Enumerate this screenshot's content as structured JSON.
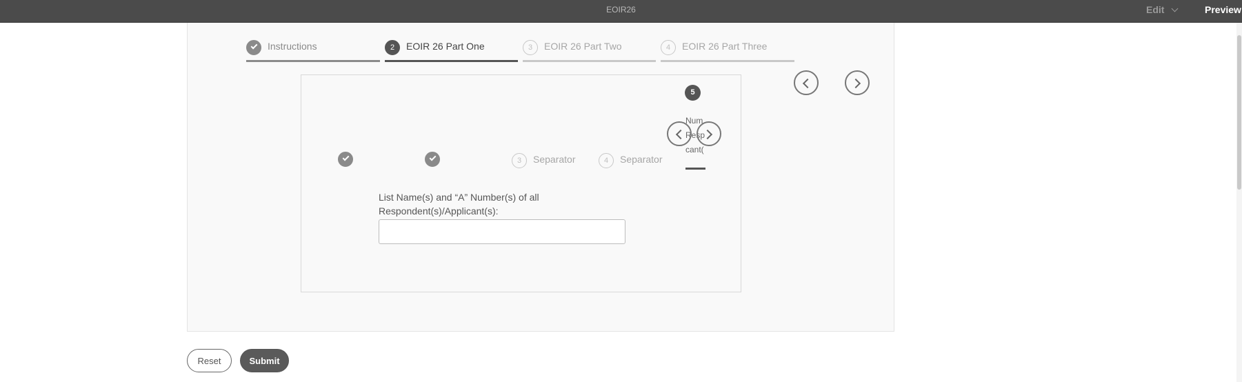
{
  "topbar": {
    "title": "EOIR26",
    "edit_label": "Edit",
    "preview_label": "Preview"
  },
  "main_wizard": {
    "steps": [
      {
        "number": "✓",
        "label": "Instructions",
        "state": "done"
      },
      {
        "number": "2",
        "label": "EOIR 26 Part One",
        "state": "active"
      },
      {
        "number": "3",
        "label": "EOIR 26 Part Two",
        "state": "todo"
      },
      {
        "number": "4",
        "label": "EOIR 26 Part Three",
        "state": "todo"
      }
    ]
  },
  "sub_wizard": {
    "steps": [
      {
        "number": "✓",
        "label": "",
        "state": "done"
      },
      {
        "number": "✓",
        "label": "",
        "state": "done"
      },
      {
        "number": "3",
        "label": "Separator",
        "state": "todo"
      },
      {
        "number": "4",
        "label": "Separator",
        "state": "todo"
      },
      {
        "number": "5",
        "label_lines": [
          "Num",
          "Resp",
          "cant("
        ],
        "state": "active"
      }
    ]
  },
  "form": {
    "field_label_line1": "List Name(s) and “A” Number(s) of all",
    "field_label_line2": "Respondent(s)/Applicant(s):",
    "field_value": ""
  },
  "actions": {
    "reset_label": "Reset",
    "submit_label": "Submit"
  },
  "icons": {
    "prev": "chevron-left-icon",
    "next": "chevron-right-icon",
    "done": "check-icon"
  },
  "colors": {
    "topbar": "#4b4b4b",
    "active": "#555555",
    "done": "#8a8a8a",
    "todo": "#c8c8c8"
  }
}
